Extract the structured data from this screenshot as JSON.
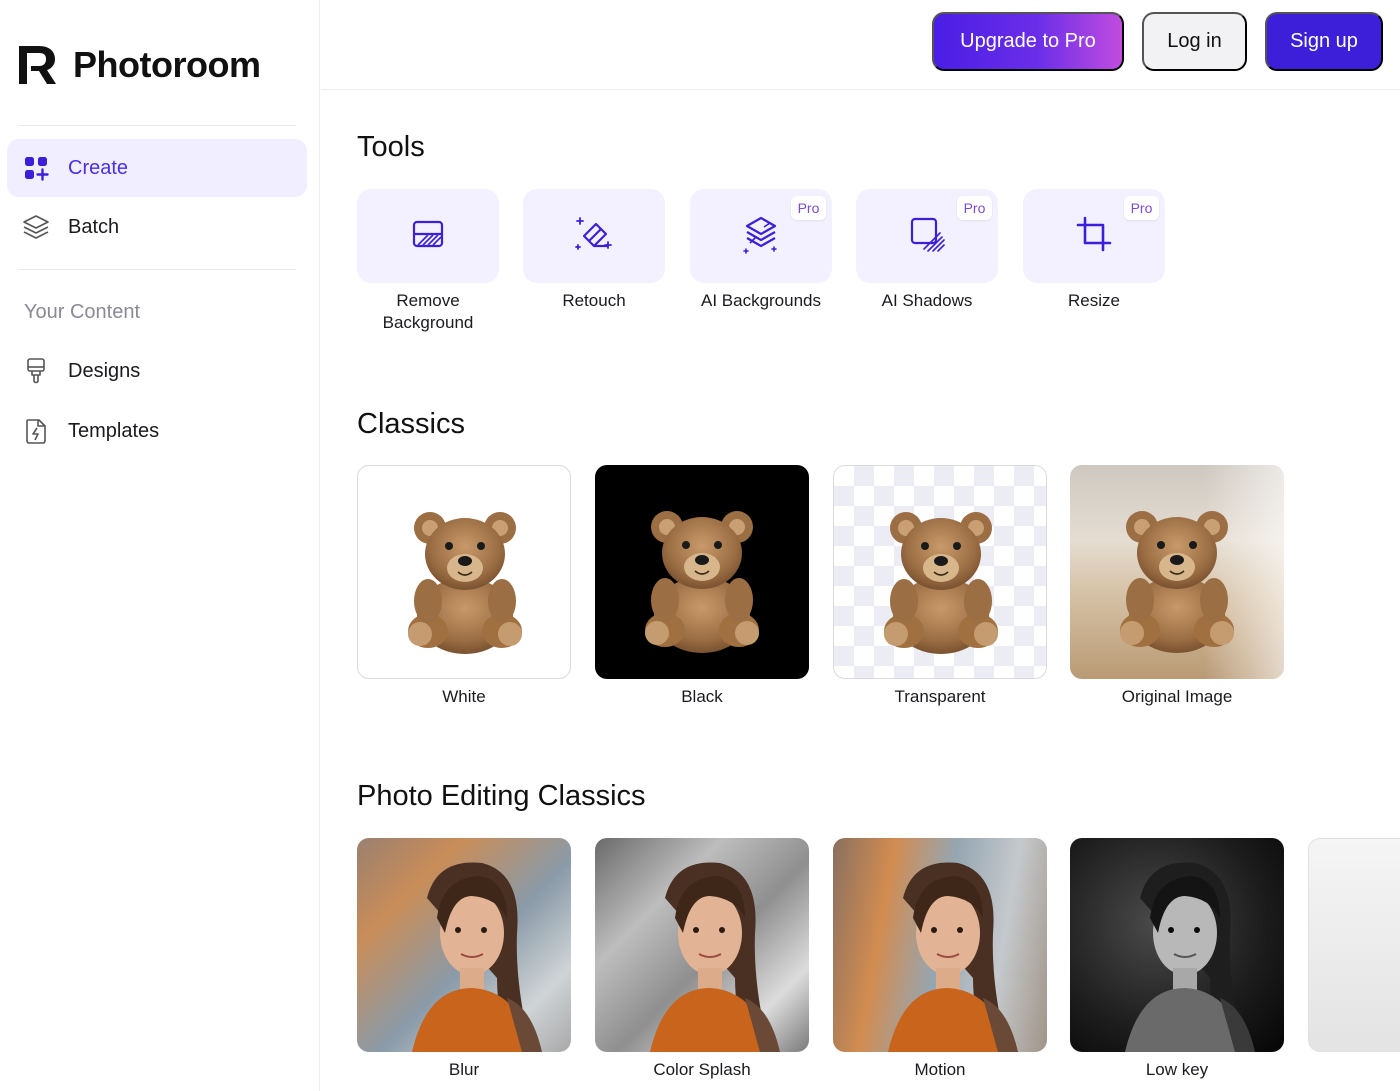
{
  "brand": {
    "name": "Photoroom"
  },
  "sidebar": {
    "items": [
      {
        "label": "Create",
        "icon": "grid-plus-icon",
        "active": true
      },
      {
        "label": "Batch",
        "icon": "layers-icon"
      }
    ],
    "section_label": "Your Content",
    "content_items": [
      {
        "label": "Designs",
        "icon": "brush-icon"
      },
      {
        "label": "Templates",
        "icon": "template-file-icon"
      }
    ]
  },
  "header": {
    "upgrade_label": "Upgrade to Pro",
    "login_label": "Log in",
    "signup_label": "Sign up"
  },
  "tools": {
    "title": "Tools",
    "items": [
      {
        "label": "Remove Background",
        "icon": "remove-background-icon",
        "pro": false
      },
      {
        "label": "Retouch",
        "icon": "eraser-sparkle-icon",
        "pro": false
      },
      {
        "label": "AI Backgrounds",
        "icon": "stack-sparkle-icon",
        "pro": true
      },
      {
        "label": "AI Shadows",
        "icon": "shadow-square-icon",
        "pro": true
      },
      {
        "label": "Resize",
        "icon": "crop-icon",
        "pro": true
      }
    ],
    "pro_badge": "Pro"
  },
  "classics": {
    "title": "Classics",
    "items": [
      {
        "label": "White"
      },
      {
        "label": "Black"
      },
      {
        "label": "Transparent"
      },
      {
        "label": "Original Image"
      }
    ]
  },
  "photo_editing": {
    "title": "Photo Editing Classics",
    "items": [
      {
        "label": "Blur"
      },
      {
        "label": "Color Splash"
      },
      {
        "label": "Motion"
      },
      {
        "label": "Low key"
      }
    ]
  },
  "colors": {
    "accent": "#3d1fd9",
    "active_bg": "#f1efff",
    "tool_bg": "#f3f1ff"
  }
}
